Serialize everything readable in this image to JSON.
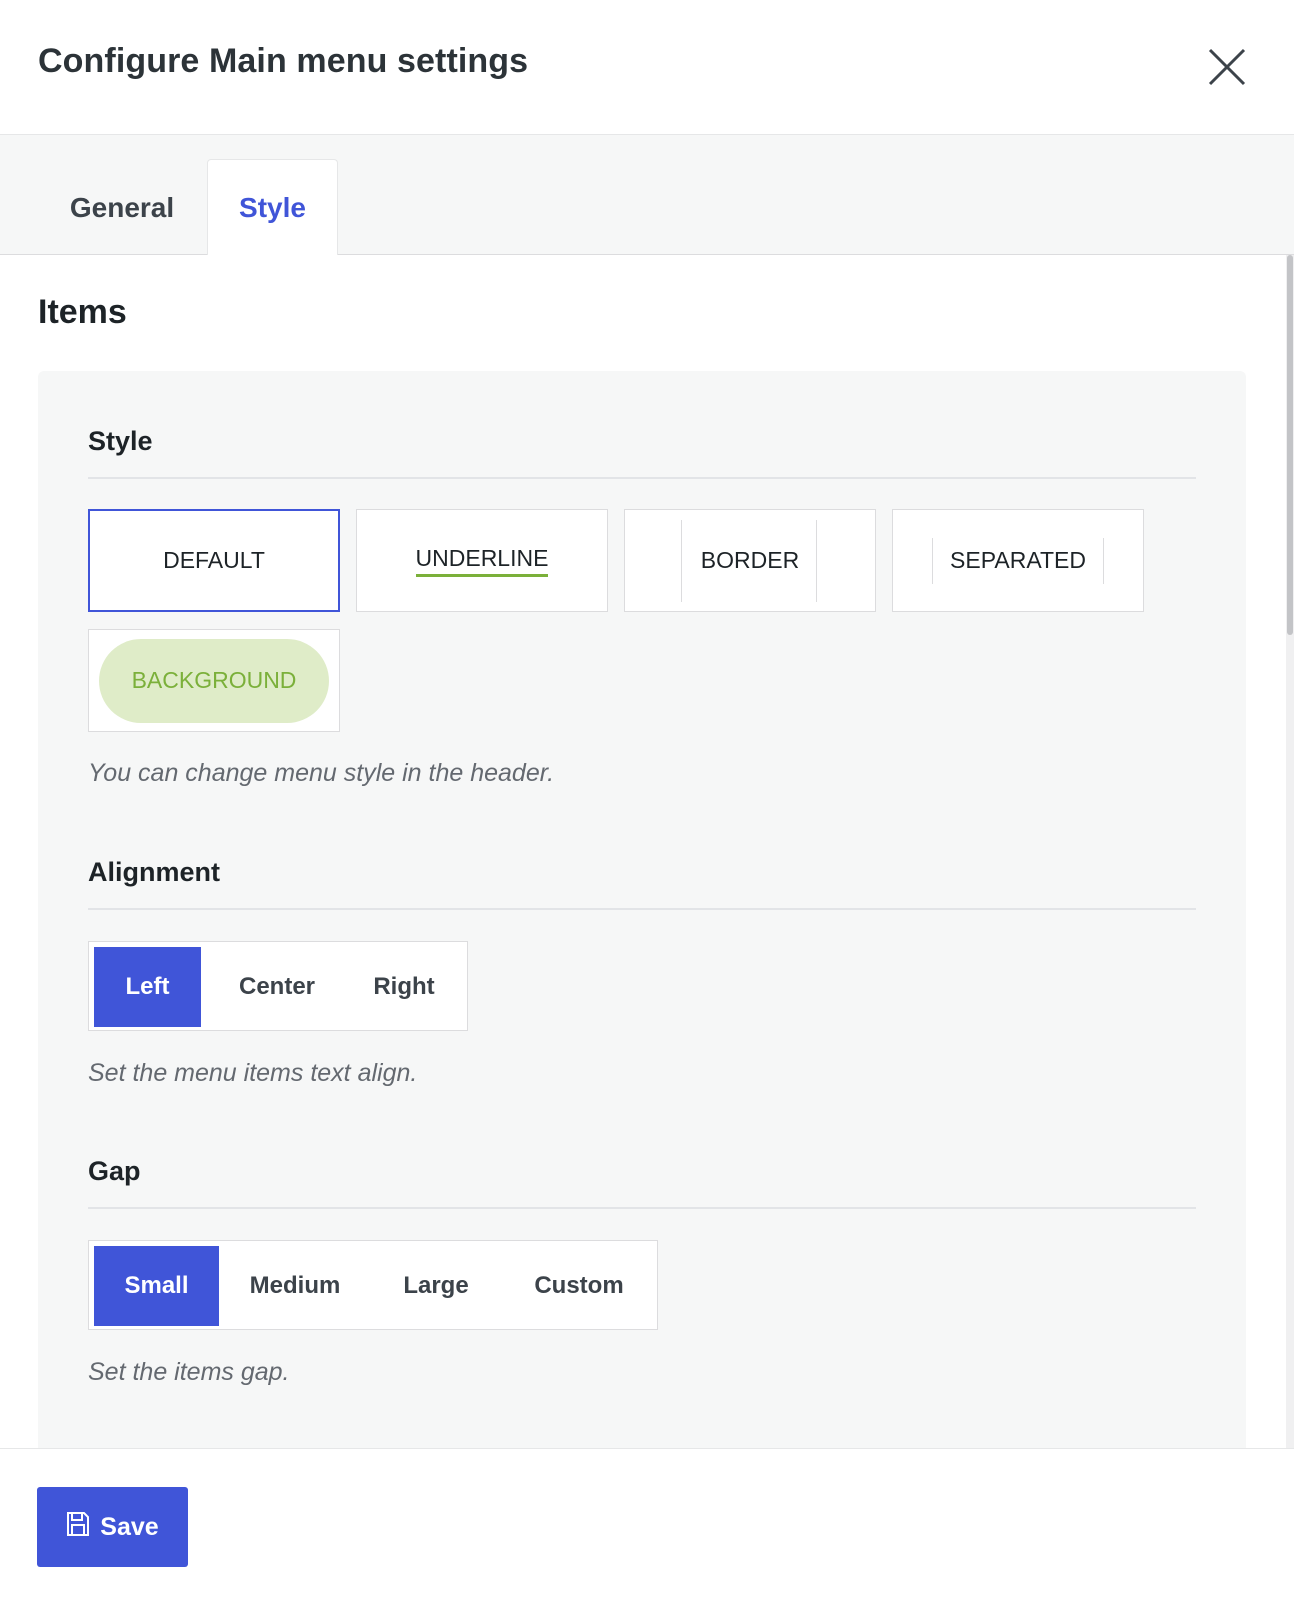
{
  "dialog": {
    "title": "Configure Main menu settings"
  },
  "tabs": [
    {
      "label": "General",
      "active": false
    },
    {
      "label": "Style",
      "active": true
    }
  ],
  "items_section": {
    "title": "Items"
  },
  "style": {
    "title": "Style",
    "options": [
      "DEFAULT",
      "UNDERLINE",
      "BORDER",
      "SEPARATED",
      "BACKGROUND"
    ],
    "selected": "DEFAULT",
    "help": "You can change menu style in the header."
  },
  "alignment": {
    "title": "Alignment",
    "options": [
      "Left",
      "Center",
      "Right"
    ],
    "selected": "Left",
    "help": "Set the menu items text align."
  },
  "gap": {
    "title": "Gap",
    "options": [
      "Small",
      "Medium",
      "Large",
      "Custom"
    ],
    "selected": "Small",
    "help": "Set the items gap."
  },
  "footer": {
    "save_label": "Save"
  },
  "icons": {
    "close": "close-icon",
    "save": "save-icon"
  },
  "colors": {
    "accent": "#4055d8",
    "success_green": "#7bb03a",
    "pill_bg": "#dfecc8",
    "panel_bg": "#f6f7f7"
  }
}
